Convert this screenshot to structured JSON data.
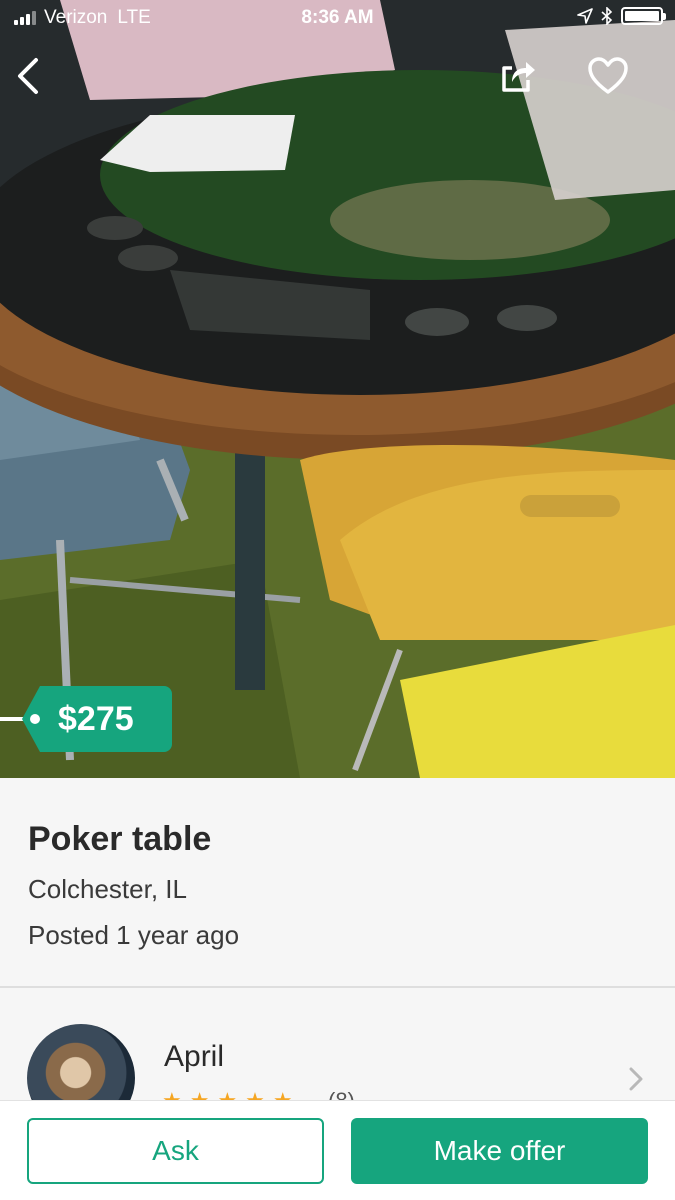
{
  "status_bar": {
    "carrier": "Verizon",
    "network": "LTE",
    "time": "8:36 AM",
    "signal_bars": 4
  },
  "nav": {
    "back_icon": "chevron-left-icon",
    "share_icon": "share-icon",
    "favorite_icon": "heart-icon"
  },
  "listing": {
    "price": "$275",
    "title": "Poker table",
    "location": "Colchester, IL",
    "posted": "Posted 1 year ago"
  },
  "seller": {
    "name": "April",
    "stars": "★★★★★",
    "rating_count": "(8)"
  },
  "actions": {
    "ask_label": "Ask",
    "offer_label": "Make offer"
  },
  "colors": {
    "accent": "#16a57e",
    "star": "#f5a623"
  }
}
